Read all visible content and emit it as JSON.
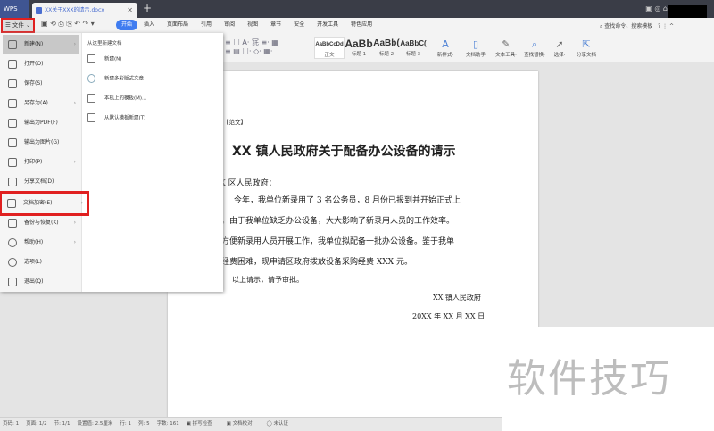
{
  "app": {
    "name": "WPS",
    "doc_tab": "XX关于XXX的请示.docx"
  },
  "toolbar": {
    "file_label": "文件",
    "tabs": [
      "开始",
      "插入",
      "页面布局",
      "引用",
      "审阅",
      "视图",
      "章节",
      "安全",
      "开发工具",
      "特色应用"
    ],
    "search": "查找命令、搜索模板"
  },
  "ribbon": {
    "styles": [
      {
        "preview": "AaBbCcDd",
        "label": "正文"
      },
      {
        "preview": "AaBb",
        "label": "标题 1"
      },
      {
        "preview": "AaBb(",
        "label": "标题 2"
      },
      {
        "preview": "AaBbC(",
        "label": "标题 3"
      }
    ],
    "buttons": [
      {
        "label": "新样式·",
        "icon": "new-style"
      },
      {
        "label": "文档助手",
        "icon": "doc-assistant"
      },
      {
        "label": "文本工具·",
        "icon": "wrench"
      },
      {
        "label": "查找替换·",
        "icon": "search"
      },
      {
        "label": "选择·",
        "icon": "cursor"
      },
      {
        "label": "分享文档",
        "icon": "share"
      }
    ]
  },
  "menu": {
    "items": [
      {
        "label": "新建(N)",
        "arrow": true
      },
      {
        "label": "打开(O)"
      },
      {
        "label": "保存(S)"
      },
      {
        "label": "另存为(A)",
        "arrow": true
      },
      {
        "label": "输出为PDF(F)"
      },
      {
        "label": "输出为图片(G)"
      },
      {
        "label": "打印(P)",
        "arrow": true
      },
      {
        "label": "分享文档(D)"
      },
      {
        "label": "文档加密(E)",
        "arrow": true
      },
      {
        "label": "备份与恢复(K)",
        "arrow": true
      },
      {
        "label": "帮助(H)",
        "arrow": true
      },
      {
        "label": "选项(L)"
      },
      {
        "label": "退出(Q)"
      }
    ],
    "submenu_title": "从这里新建文档",
    "submenu": [
      "新建(N)",
      "新建多彩版式文章",
      "本机上的模板(M)...",
      "从默认模板新建(T)"
    ]
  },
  "document": {
    "tag": "【范文】",
    "title": "XX 镇人民政府关于配备办公设备的请示",
    "salutation": "XX 区人民政府：",
    "lines": [
      "　　今年，我单位新录用了 3 名公务员，8 月份已报到并开始正式上",
      "班。由于我单位缺乏办公设备，大大影响了新录用人员的工作效率。",
      "为方便新录用人员开展工作，我单位拟配备一批办公设备。鉴于我单",
      "位经费困难，现申请区政府拨放设备采购经费 XXX 元。"
    ],
    "closing": "　　以上请示，请予审批。",
    "signature": "XX 镇人民政府",
    "date": "20XX 年 XX 月 XX 日"
  },
  "status": [
    "页码: 1",
    "页面: 1/2",
    "节: 1/1",
    "设置值: 2.5厘米",
    "行: 1",
    "列: 5",
    "字数: 161",
    "拼写检查",
    "文档校对",
    "未认证"
  ],
  "watermark": "软件技巧"
}
